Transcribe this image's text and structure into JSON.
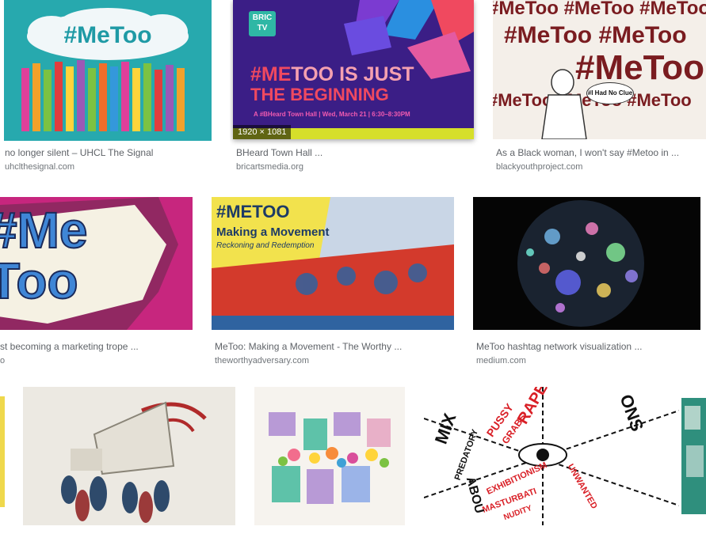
{
  "results": [
    {
      "title": "no longer silent – UHCL The Signal",
      "site": "uhclthesignal.com",
      "image_text": "#MeToo",
      "colors": {
        "bg": "#27a9ae",
        "cloud": "#f1f7f9",
        "text": "#1f9aa5"
      }
    },
    {
      "title": "BHeard Town Hall ...",
      "site": "bricartsmedia.org",
      "dimensions": "1920 × 1081",
      "image_texts": {
        "logo_line1": "BRIC",
        "logo_line2": "TV",
        "headline_me": "#ME",
        "headline_rest": "TOO IS JUST",
        "headline_line2": "THE BEGINNING",
        "subline": "A #BHeard Town Hall | Wed, March 21 | 6:30–8:30PM"
      },
      "colors": {
        "bg": "#3b1e86",
        "accent": "#f0495f",
        "bottom": "#d6df2a"
      }
    },
    {
      "title": "As a Black woman, I won't say #Metoo in ...",
      "site": "blackyouthproject.com",
      "image_texts": {
        "pattern_word": "#MeToo",
        "bubble": "#I Had No Clue"
      },
      "colors": {
        "ink": "#7a1c20",
        "bg": "#f4efe9"
      }
    },
    {
      "title": "st becoming a marketing trope ...",
      "site": "o",
      "image_text": "#Me Too",
      "colors": {
        "bg": "#c7267e",
        "burst": "#f5f1e3",
        "letters": "#3f86d6"
      }
    },
    {
      "title": "MeToo: Making a Movement - The Worthy ...",
      "site": "theworthyadversary.com",
      "image_texts": {
        "hashtag": "#METOO",
        "heading": "Making a Movement",
        "subheading": "Reckoning and Redemption"
      },
      "colors": {
        "yellow": "#f2e24d",
        "red": "#d33a2c",
        "blue": "#2f63a0"
      }
    },
    {
      "title": "MeToo hashtag network visualization ...",
      "site": "medium.com",
      "colors": {
        "bg": "#050505",
        "globe": "#1a2330"
      }
    },
    {
      "colors": {
        "bg": "#efd84c"
      }
    },
    {
      "colors": {
        "bg": "#ece9e2",
        "megaphone": "#e4e0d6",
        "wave": "#b02a2a"
      }
    },
    {
      "colors": {
        "bg": "#f6f3ee",
        "purple": "#b89ad6",
        "teal": "#5ec2a9"
      }
    },
    {
      "image_texts": {
        "w1": "MIX",
        "w2": "RAPE",
        "w3": "PUSSY",
        "w4": "GRABS",
        "w5": "EXHIBITIONISM",
        "w6": "MASTURBATI",
        "w7": "NUDITY",
        "w8": "UNWANTED",
        "w9": "PREDATORY",
        "w10": "ONS",
        "w11": "ABOU"
      },
      "colors": {
        "ink": "#111111",
        "red": "#d91f26",
        "blue": "#1e4fbf"
      }
    },
    {
      "colors": {
        "bg": "#2f8f7d"
      }
    }
  ]
}
